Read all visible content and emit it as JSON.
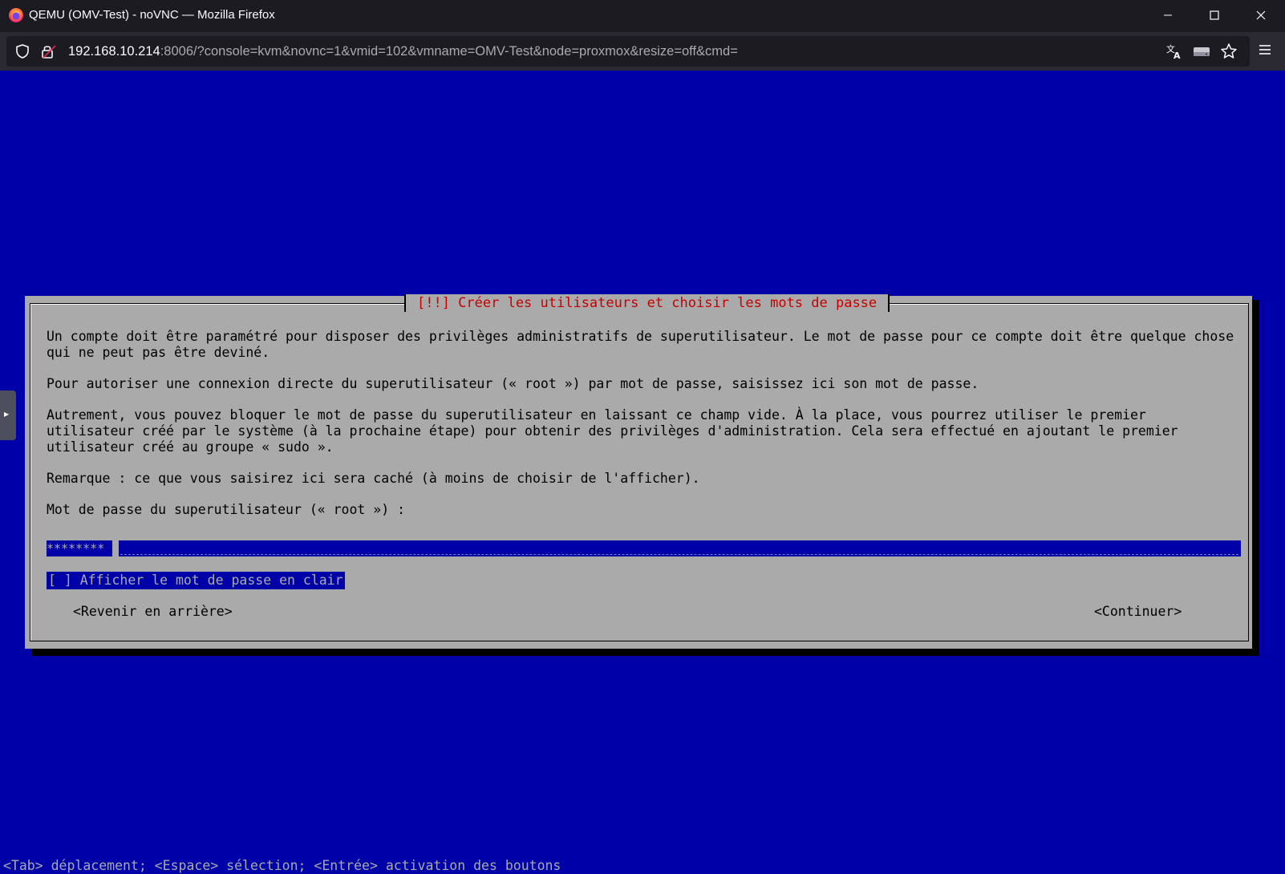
{
  "browser": {
    "window_title": "QEMU (OMV-Test) - noVNC — Mozilla Firefox",
    "url_host": "192.168.10.214",
    "url_rest": ":8006/?console=kvm&novnc=1&vmid=102&vmname=OMV-Test&node=proxmox&resize=off&cmd="
  },
  "installer": {
    "dialog_title": "[!!] Créer les utilisateurs et choisir les mots de passe",
    "para1_line1": "Un compte doit être paramétré pour disposer des privilèges administratifs de superutilisateur. Le mot de passe pour ce compte doit être quelque chose",
    "para1_line2": "qui ne peut pas être deviné.",
    "para2": "Pour autoriser une connexion directe du superutilisateur (« root ») par mot de passe, saisissez ici son mot de passe.",
    "para3_line1": "Autrement, vous pouvez bloquer le mot de passe du superutilisateur en laissant ce champ vide. À la place, vous pourrez utiliser le premier",
    "para3_line2": "utilisateur créé par le système (à la prochaine étape) pour obtenir des privilèges d'administration. Cela sera effectué en ajoutant le premier",
    "para3_line3": "utilisateur créé au groupe « sudo ».",
    "para4": "Remarque : ce que vous saisirez ici sera caché (à moins de choisir de l'afficher).",
    "password_label": "Mot de passe du superutilisateur (« root ») :",
    "password_value": "********",
    "show_password_checkbox": "[ ] Afficher le mot de passe en clair",
    "back_button": "<Revenir en arrière>",
    "continue_button": "<Continuer>",
    "help_line": "<Tab> déplacement; <Espace> sélection; <Entrée> activation des boutons"
  },
  "colors": {
    "console_blue": "#0000a8",
    "dialog_gray": "#aaaaaa",
    "title_red": "#c80000"
  }
}
